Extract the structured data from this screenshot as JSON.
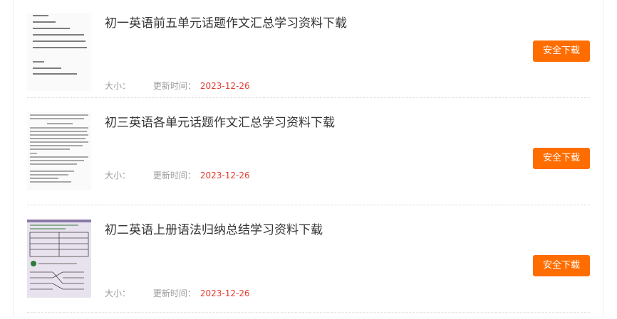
{
  "list": {
    "items": [
      {
        "title": "初一英语前五单元话题作文汇总学习资料下载",
        "size_label": "大小：",
        "size_value": "",
        "update_label": "更新时间：",
        "date": "2023-12-26",
        "button_label": "安全下载",
        "thumb_icon": "document-thumbnail"
      },
      {
        "title": "初三英语各单元话题作文汇总学习资料下载",
        "size_label": "大小：",
        "size_value": "",
        "update_label": "更新时间：",
        "date": "2023-12-26",
        "button_label": "安全下载",
        "thumb_icon": "document-thumbnail"
      },
      {
        "title": "初二英语上册语法归纳总结学习资料下载",
        "size_label": "大小：",
        "size_value": "",
        "update_label": "更新时间：",
        "date": "2023-12-26",
        "button_label": "安全下载",
        "thumb_icon": "worksheet-photo-thumbnail"
      }
    ]
  },
  "colors": {
    "button_bg": "#ff6d00",
    "date_text": "#e23a2e",
    "title_text": "#333333",
    "meta_text": "#999999"
  }
}
